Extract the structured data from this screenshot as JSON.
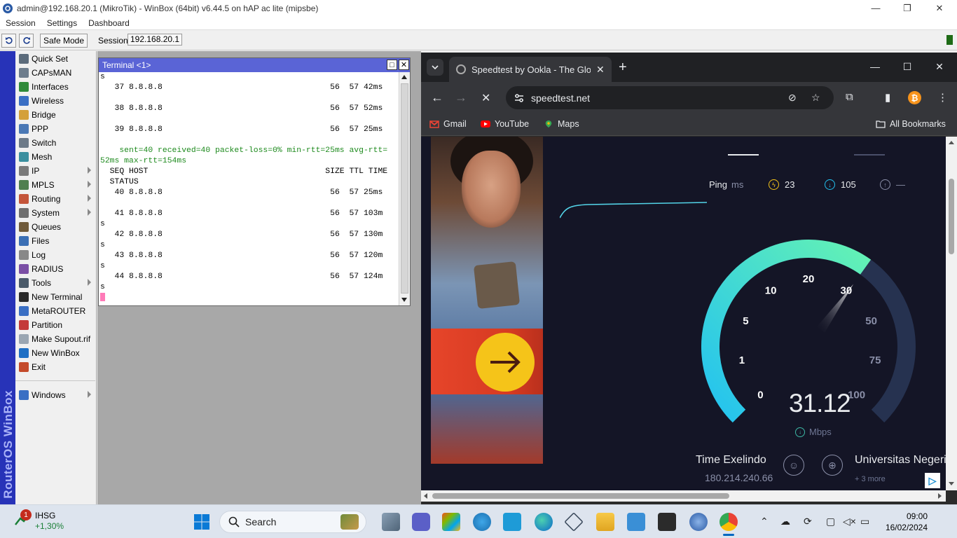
{
  "winbox": {
    "title": "admin@192.168.20.1 (MikroTik) - WinBox (64bit) v6.44.5 on hAP ac lite (mipsbe)",
    "menus": [
      "Session",
      "Settings",
      "Dashboard"
    ],
    "safe_mode_label": "Safe Mode",
    "session_label": "Session:",
    "session_value": "192.168.20.1",
    "side_brand": "RouterOS WinBox",
    "side_items": [
      {
        "label": "Quick Set",
        "icon": "quick-set-icon",
        "submenu": false
      },
      {
        "label": "CAPsMAN",
        "icon": "capsman-icon",
        "submenu": false
      },
      {
        "label": "Interfaces",
        "icon": "interfaces-icon",
        "submenu": false
      },
      {
        "label": "Wireless",
        "icon": "wireless-icon",
        "submenu": false
      },
      {
        "label": "Bridge",
        "icon": "bridge-icon",
        "submenu": false
      },
      {
        "label": "PPP",
        "icon": "ppp-icon",
        "submenu": false
      },
      {
        "label": "Switch",
        "icon": "switch-icon",
        "submenu": false
      },
      {
        "label": "Mesh",
        "icon": "mesh-icon",
        "submenu": false
      },
      {
        "label": "IP",
        "icon": "ip-icon",
        "submenu": true
      },
      {
        "label": "MPLS",
        "icon": "mpls-icon",
        "submenu": true
      },
      {
        "label": "Routing",
        "icon": "routing-icon",
        "submenu": true
      },
      {
        "label": "System",
        "icon": "system-icon",
        "submenu": true
      },
      {
        "label": "Queues",
        "icon": "queues-icon",
        "submenu": false
      },
      {
        "label": "Files",
        "icon": "files-icon",
        "submenu": false
      },
      {
        "label": "Log",
        "icon": "log-icon",
        "submenu": false
      },
      {
        "label": "RADIUS",
        "icon": "radius-icon",
        "submenu": false
      },
      {
        "label": "Tools",
        "icon": "tools-icon",
        "submenu": true
      },
      {
        "label": "New Terminal",
        "icon": "terminal-icon",
        "submenu": false
      },
      {
        "label": "MetaROUTER",
        "icon": "metarouter-icon",
        "submenu": false
      },
      {
        "label": "Partition",
        "icon": "partition-icon",
        "submenu": false
      },
      {
        "label": "Make Supout.rif",
        "icon": "supout-icon",
        "submenu": false
      },
      {
        "label": "New WinBox",
        "icon": "winbox-icon",
        "submenu": false
      },
      {
        "label": "Exit",
        "icon": "exit-icon",
        "submenu": false
      },
      {
        "label": "Windows",
        "icon": "windows-icon",
        "submenu": true
      }
    ],
    "colors": {
      "brand_bar": "#2733b8",
      "terminal_title": "#5a64d6"
    }
  },
  "terminal": {
    "title": "Terminal <1>",
    "lines": [
      {
        "text": "s",
        "green": false
      },
      {
        "text": "   37 8.8.8.8                                   56  57 42ms",
        "green": false
      },
      {
        "text": "",
        "green": false
      },
      {
        "text": "   38 8.8.8.8                                   56  57 52ms",
        "green": false
      },
      {
        "text": "",
        "green": false
      },
      {
        "text": "   39 8.8.8.8                                   56  57 25ms",
        "green": false
      },
      {
        "text": "",
        "green": false
      },
      {
        "text": "    sent=40 received=40 packet-loss=0% min-rtt=25ms avg-rtt=",
        "green": true
      },
      {
        "text": "52ms max-rtt=154ms",
        "green": true
      },
      {
        "text": "  SEQ HOST                                     SIZE TTL TIME",
        "green": false
      },
      {
        "text": "  STATUS",
        "green": false
      },
      {
        "text": "   40 8.8.8.8                                   56  57 25ms",
        "green": false
      },
      {
        "text": "",
        "green": false
      },
      {
        "text": "   41 8.8.8.8                                   56  57 103m",
        "green": false
      },
      {
        "text": "s",
        "green": false
      },
      {
        "text": "   42 8.8.8.8                                   56  57 130m",
        "green": false
      },
      {
        "text": "s",
        "green": false
      },
      {
        "text": "   43 8.8.8.8                                   56  57 120m",
        "green": false
      },
      {
        "text": "s",
        "green": false
      },
      {
        "text": "   44 8.8.8.8                                   56  57 124m",
        "green": false
      },
      {
        "text": "s",
        "green": false
      }
    ]
  },
  "chrome": {
    "tab_title": "Speedtest by Ookla - The Global Broadband Speed Test",
    "url": "speedtest.net",
    "bookmarks": [
      "Gmail",
      "YouTube",
      "Maps"
    ],
    "all_bookmarks": "All Bookmarks",
    "speedtest": {
      "ping_label": "Ping",
      "ping_unit": "ms",
      "jitter": "23",
      "download_ping": "105",
      "upload_ping": "—",
      "gauge_labels": [
        "0",
        "1",
        "5",
        "10",
        "20",
        "30",
        "50",
        "75",
        "100"
      ],
      "gauge_value": 31.12,
      "speed": "31.12",
      "unit": "Mbps",
      "host_name": "Time Exelindo",
      "host_ip": "180.214.240.66",
      "server_name": "Universitas Negeri",
      "server_more": "+ 3 more",
      "colors": {
        "gauge_start": "#23c2f0",
        "gauge_end": "#64f2b4",
        "background": "#141526"
      }
    }
  },
  "taskbar": {
    "badge": "1",
    "stock_name": "IHSG",
    "stock_change": "+1,30%",
    "search_label": "Search",
    "time": "09:00",
    "date": "16/02/2024"
  }
}
